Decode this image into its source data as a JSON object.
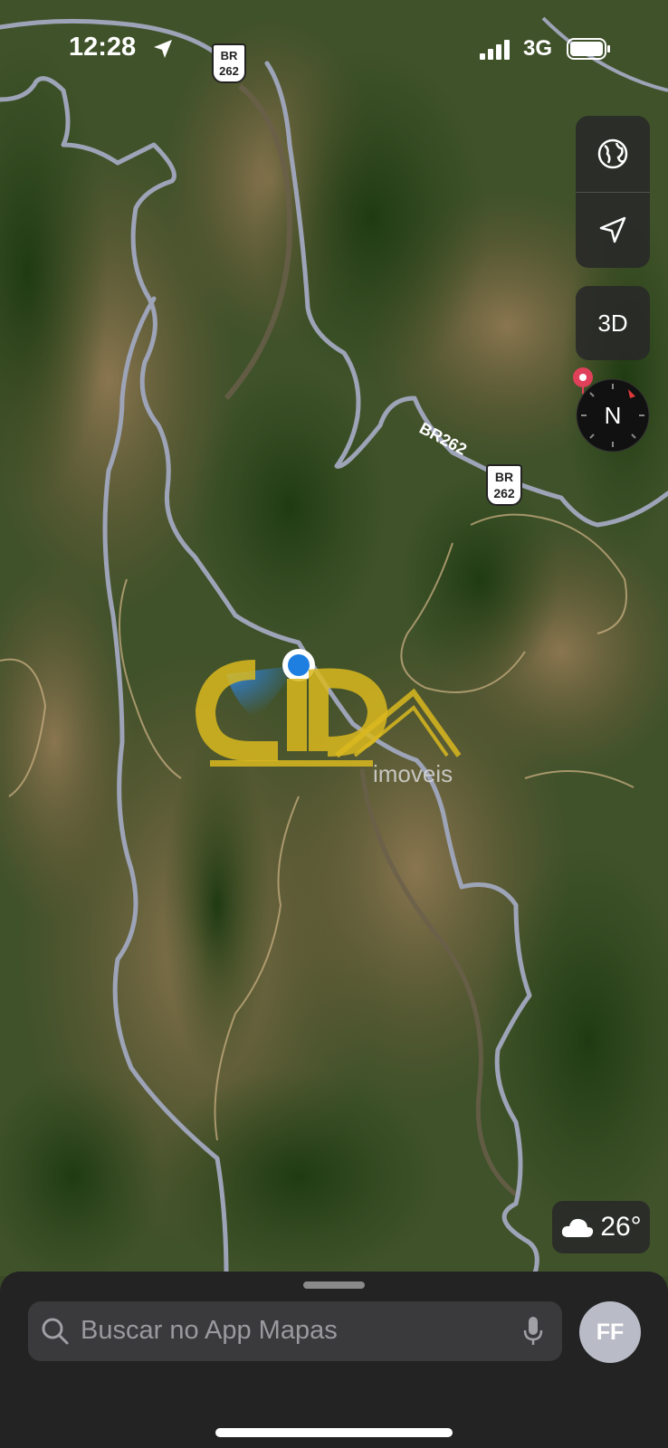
{
  "status_bar": {
    "time": "12:28",
    "network": "3G"
  },
  "map": {
    "road_shields": [
      {
        "line1": "BR",
        "line2": "262"
      },
      {
        "line1": "BR",
        "line2": "262"
      }
    ],
    "road_label": "BR262",
    "map_type_icon": "globe-icon",
    "tracking_icon": "location-arrow-icon",
    "view_mode_label": "3D",
    "compass_label": "N",
    "temperature": "26°",
    "weather_icon": "cloud-icon",
    "watermark_brand": "imoveis"
  },
  "bottom_sheet": {
    "search_placeholder": "Buscar no App Mapas",
    "avatar_initials": "FF"
  },
  "colors": {
    "road": "#9ea4b8",
    "forest": "#2f4a1e",
    "terrain": "#7a6a45",
    "user_location": "#1f7fe0",
    "watermark": "#d9b81f"
  }
}
